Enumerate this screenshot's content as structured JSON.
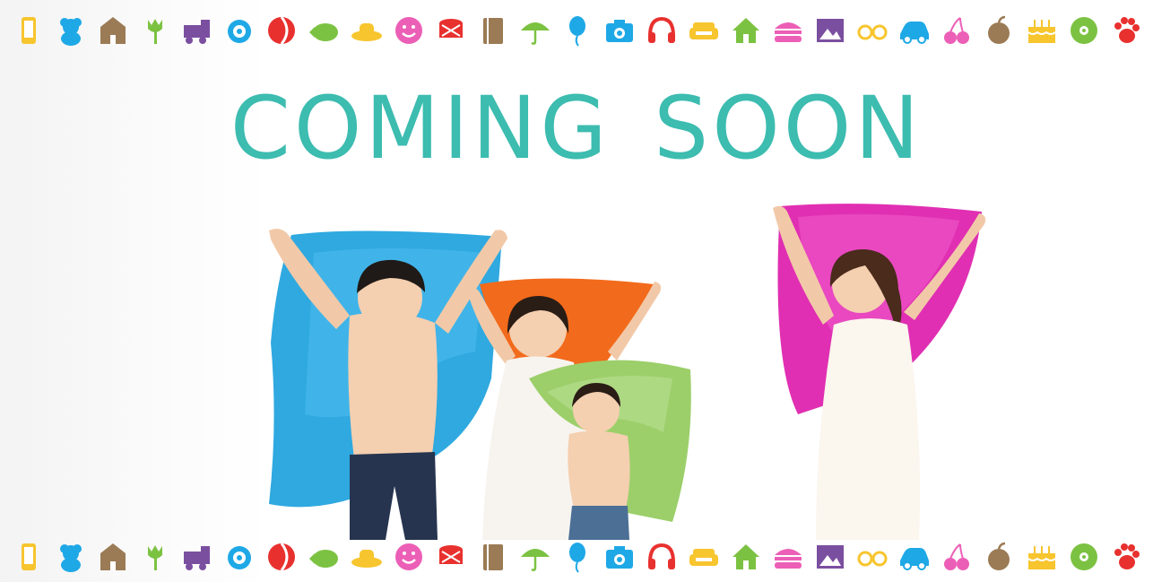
{
  "banner": {
    "title": "COMING SOON"
  },
  "icon_strip": {
    "icons": [
      {
        "name": "phone-icon",
        "color": "#f7c52e"
      },
      {
        "name": "teddy-bear-icon",
        "color": "#1fa8e6"
      },
      {
        "name": "school-building-icon",
        "color": "#9b7b55"
      },
      {
        "name": "tulip-icon",
        "color": "#7cc242"
      },
      {
        "name": "toy-train-icon",
        "color": "#7b4fa0"
      },
      {
        "name": "baby-bib-icon",
        "color": "#1fa8e6"
      },
      {
        "name": "beach-ball-icon",
        "color": "#e8312f"
      },
      {
        "name": "pineapple-icon",
        "color": "#7cc242"
      },
      {
        "name": "cowboy-hat-icon",
        "color": "#f7c52e"
      },
      {
        "name": "smiley-face-icon",
        "color": "#ec5fb6"
      },
      {
        "name": "drum-icon",
        "color": "#e8312f"
      },
      {
        "name": "book-icon",
        "color": "#9b7b55"
      },
      {
        "name": "umbrella-icon",
        "color": "#7cc242"
      },
      {
        "name": "balloon-icon",
        "color": "#1fa8e6"
      },
      {
        "name": "camera-icon",
        "color": "#1fa8e6"
      },
      {
        "name": "headphones-icon",
        "color": "#e8312f"
      },
      {
        "name": "sofa-icon",
        "color": "#f7c52e"
      },
      {
        "name": "house-icon",
        "color": "#7cc242"
      },
      {
        "name": "burger-icon",
        "color": "#ec5fb6"
      },
      {
        "name": "picture-frame-icon",
        "color": "#7b4fa0"
      },
      {
        "name": "glasses-icon",
        "color": "#f7c52e"
      },
      {
        "name": "car-icon",
        "color": "#1fa8e6"
      },
      {
        "name": "cherries-icon",
        "color": "#ec5fb6"
      },
      {
        "name": "apple-icon",
        "color": "#9b7b55"
      },
      {
        "name": "birthday-cake-icon",
        "color": "#f7c52e"
      },
      {
        "name": "music-disc-icon",
        "color": "#7cc242"
      },
      {
        "name": "paw-print-icon",
        "color": "#e8312f"
      }
    ]
  },
  "colors": {
    "title": "#3dbcb0"
  }
}
